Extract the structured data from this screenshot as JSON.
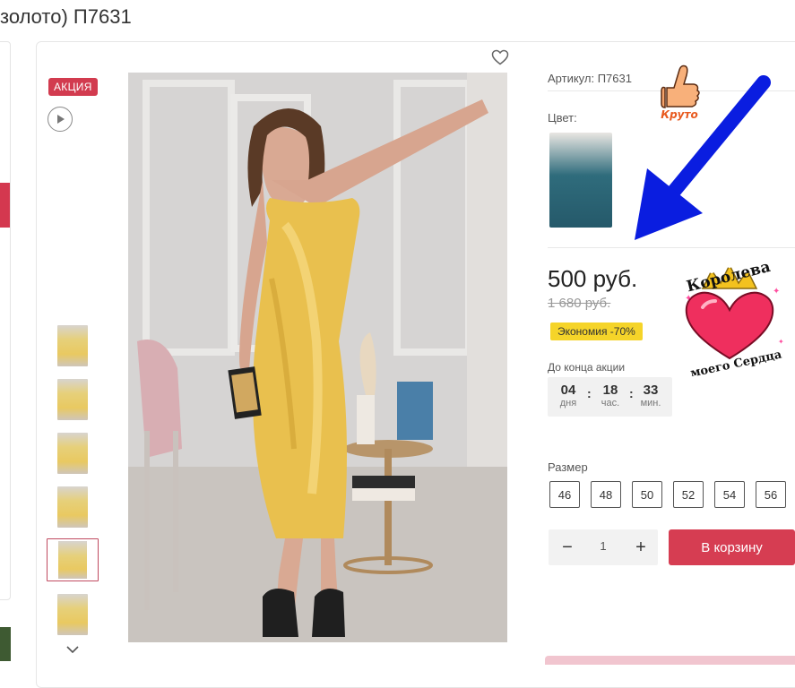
{
  "page": {
    "title": "золото) П7631"
  },
  "gallery": {
    "badge": "АКЦИЯ",
    "thumbnail_count": 6,
    "active_thumbnail": 5
  },
  "product": {
    "sku": "Артикул: П7631",
    "color_label": "Цвет:",
    "price": "500 руб.",
    "old_price": "1 680 руб.",
    "saving": "Экономия -70%",
    "countdown_label": "До конца акции",
    "countdown": [
      {
        "value": "04",
        "unit": "дня"
      },
      {
        "value": "18",
        "unit": "час."
      },
      {
        "value": "33",
        "unit": "мин."
      }
    ],
    "size_label": "Размер",
    "sizes": [
      "46",
      "48",
      "50",
      "52",
      "54",
      "56"
    ],
    "quantity": "1",
    "add_to_cart": "В корзину"
  },
  "stickers": {
    "thumb_text": "Круто",
    "queen_text_top": "Королева",
    "queen_text_bottom": "моего Сердца"
  },
  "colors": {
    "accent": "#d63d52",
    "saving_bg": "#f5d429",
    "arrow": "#0a1de0"
  }
}
